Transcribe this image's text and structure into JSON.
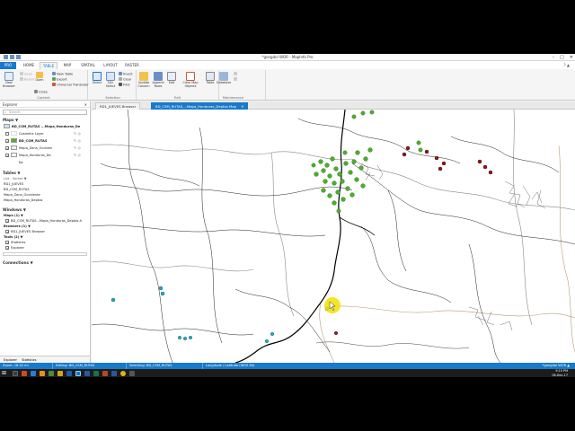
{
  "window": {
    "title": "*gongdol WOR - MapInfo Pro",
    "min": "–",
    "max": "□",
    "close": "✕"
  },
  "ribbon_tabs": [
    {
      "label": "PRO"
    },
    {
      "label": "HOME"
    },
    {
      "label": "TABLE"
    },
    {
      "label": "MAP"
    },
    {
      "label": "SPATIAL"
    },
    {
      "label": "LAYOUT"
    },
    {
      "label": "RASTER"
    }
  ],
  "active_tab": "TABLE",
  "user_info": "?  ▲",
  "ribbon": {
    "content": {
      "label": "Content",
      "new_browser": "New Browser",
      "open": "Open",
      "close": "Close",
      "new_table": "New Table",
      "export": "Export",
      "universal_translator": "Universal Translator",
      "save": "Save",
      "revert": "Revert"
    },
    "selection": {
      "label": "Selection",
      "select": "Select",
      "sql_select": "SQL Select",
      "invert": "Invert",
      "clear": "Clear",
      "find": "Find"
    },
    "edit": {
      "label": "Edit",
      "update_column": "Update Column",
      "append_rows": "Append Rows",
      "edit_btn": "Edit",
      "clear_map_objects": "Clear Map Objects"
    },
    "maintenance": {
      "label": "Maintenance",
      "table": "Table",
      "database": "Database"
    }
  },
  "explorer": {
    "title": "Explorer",
    "close": "✕",
    "search_placeholder": "Search",
    "maps_header": "Maps ▼",
    "map_name": "BD_CSM_RUTAS ...Mapa_Honduras_De",
    "layers": [
      {
        "name": "Cosmetic Layer",
        "checked": false
      },
      {
        "name": "BD_CSM_RUTAS",
        "checked": true
      },
      {
        "name": "Mapa_Zona_Occiden",
        "checked": true
      },
      {
        "name": "Mapa_Honduras_De",
        "checked": true
      },
      {
        "name": "Ka",
        "checked": false
      }
    ],
    "tables_header": "Tables ▼",
    "tables_sort": "List · Sorted ▼",
    "tables": [
      "RD1_JUEVES",
      "BD_CSM_RUTAS",
      "Mapa_Zona_Occidente",
      "Mapa_Honduras_Deptos"
    ],
    "windows_header": "Windows ▼",
    "maps_sub": "Maps  (1)  ▼",
    "map_window": "BD_CSM_RUTAS...Mapa_Honduras_Deptos A",
    "browsers_sub": "Browsers  (1)  ▼",
    "browser_window": "RD1_JUEVES Browser",
    "tools_sub": "Tools  (2)  ▼",
    "tools": [
      "Statistics",
      "Explorer"
    ],
    "connections_header": "Connections ▼",
    "bottom_tabs": [
      "Explorer",
      "Statistics"
    ]
  },
  "map_tabs": [
    {
      "label": "RD1_JUEVES Browser"
    },
    {
      "label": "BD_CSM_RUTAS,...Mapa_Honduras_Deptos Map"
    }
  ],
  "map_close": "✕",
  "status": {
    "zoom": "Zoom: 18.32 mi",
    "editing": "Editing: BD_CSM_RUTAS",
    "selecting": "Selecting: BD_CSM_RUTAS",
    "coords": "Longitude / Latitude (WGS 84)",
    "workspace": "*gongdol WOR  ▲"
  },
  "taskbar": {
    "time": "9:15 PM",
    "date": "06-Dec-17"
  },
  "colors": {
    "accent": "#1979ca",
    "points_green": "#4caf2a",
    "points_red": "#8b1a1a",
    "points_cyan": "#2aa7b8",
    "highlight_yellow": "#f5e100"
  }
}
